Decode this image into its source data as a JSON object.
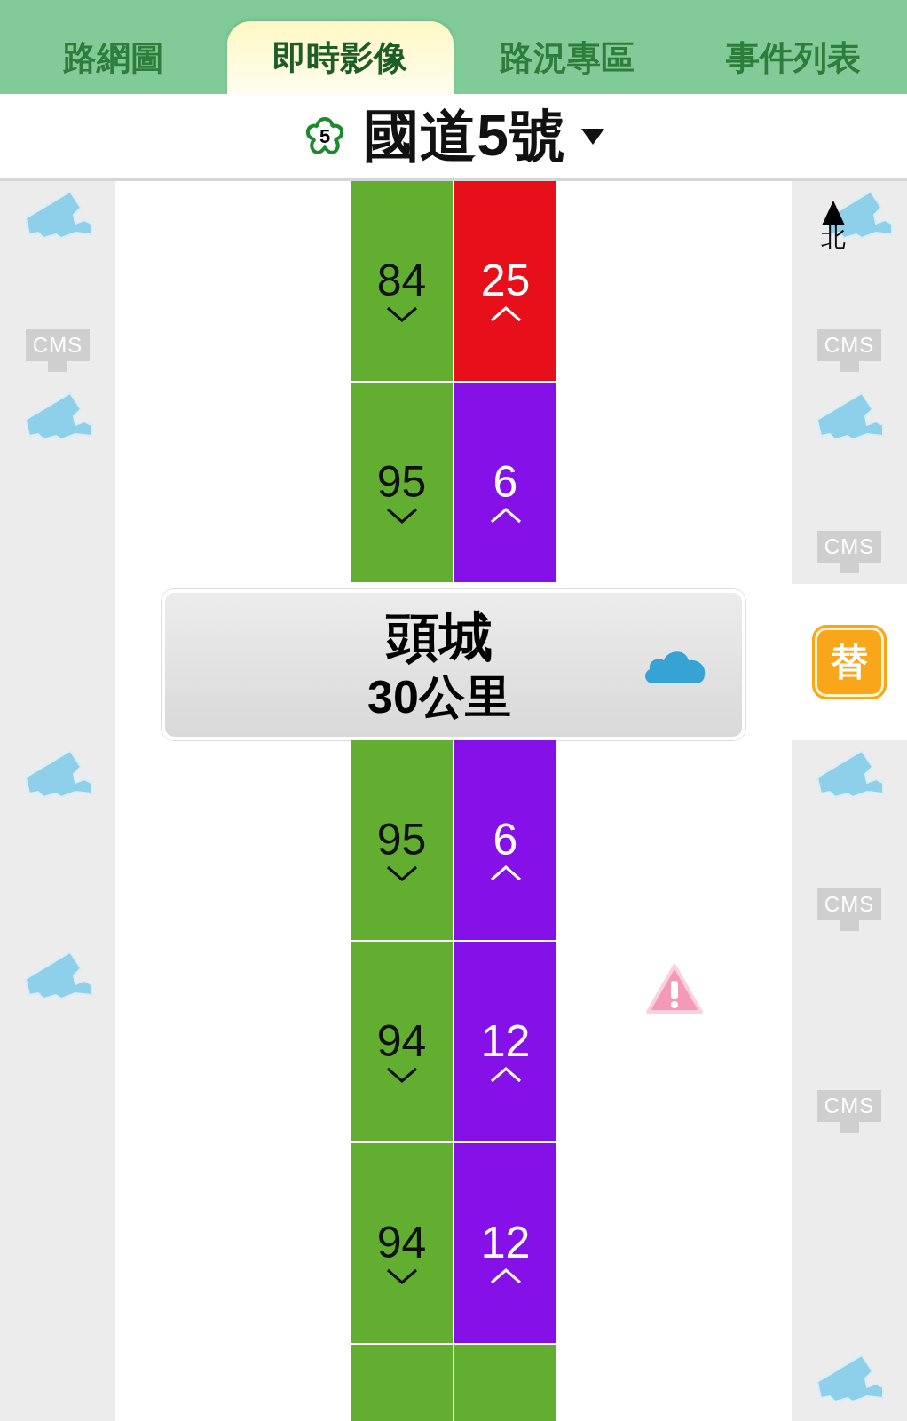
{
  "tabs": [
    {
      "label": "路網圖",
      "selected": false
    },
    {
      "label": "即時影像",
      "selected": true
    },
    {
      "label": "路況專區",
      "selected": false
    },
    {
      "label": "事件列表",
      "selected": false
    }
  ],
  "road_selector": {
    "route_number": "5",
    "title": "國道5號"
  },
  "strip": [
    {
      "kind": "segment",
      "lanes": [
        {
          "value": "84",
          "kind": "down",
          "color": "#62ae31"
        },
        {
          "value": "25",
          "kind": "up",
          "color": "#e60f1a"
        }
      ],
      "left": {
        "upper": {
          "kind": "camera"
        },
        "lower": {
          "kind": "cms",
          "label": "CMS"
        }
      },
      "right": {
        "upper": {
          "kind": "camera_north",
          "label": "北"
        },
        "lower": {
          "kind": "cms",
          "label": "CMS"
        }
      }
    },
    {
      "kind": "segment",
      "lanes": [
        {
          "value": "95",
          "kind": "down",
          "color": "#62ae31"
        },
        {
          "value": "6",
          "kind": "up",
          "color": "#8610e8"
        }
      ],
      "left": {
        "upper": {
          "kind": "camera"
        }
      },
      "right": {
        "upper": {
          "kind": "camera"
        },
        "lower": {
          "kind": "cms",
          "label": "CMS"
        }
      }
    },
    {
      "kind": "interchange",
      "name": "頭城",
      "distance": "30公里",
      "badge": "替"
    },
    {
      "kind": "segment",
      "lanes": [
        {
          "value": "95",
          "kind": "down",
          "color": "#62ae31"
        },
        {
          "value": "6",
          "kind": "up",
          "color": "#8610e8"
        }
      ],
      "left": {
        "upper": {
          "kind": "camera"
        }
      },
      "right": {
        "upper": {
          "kind": "camera"
        },
        "lower": {
          "kind": "cms",
          "label": "CMS"
        }
      }
    },
    {
      "kind": "segment",
      "lanes": [
        {
          "value": "94",
          "kind": "down",
          "color": "#62ae31"
        },
        {
          "value": "12",
          "kind": "up",
          "color": "#8610e8"
        }
      ],
      "left": {
        "upper": {
          "kind": "camera"
        }
      },
      "right": {
        "lower": {
          "kind": "cms",
          "label": "CMS"
        }
      },
      "warning": true
    },
    {
      "kind": "segment",
      "lanes": [
        {
          "value": "94",
          "kind": "down",
          "color": "#62ae31"
        },
        {
          "value": "12",
          "kind": "up",
          "color": "#8610e8"
        }
      ]
    },
    {
      "kind": "segment",
      "lanes": [
        {
          "kind": "blank",
          "color": "#62ae31"
        },
        {
          "kind": "blank",
          "color": "#62ae31"
        }
      ],
      "right": {
        "upper": {
          "kind": "camera"
        }
      }
    }
  ]
}
